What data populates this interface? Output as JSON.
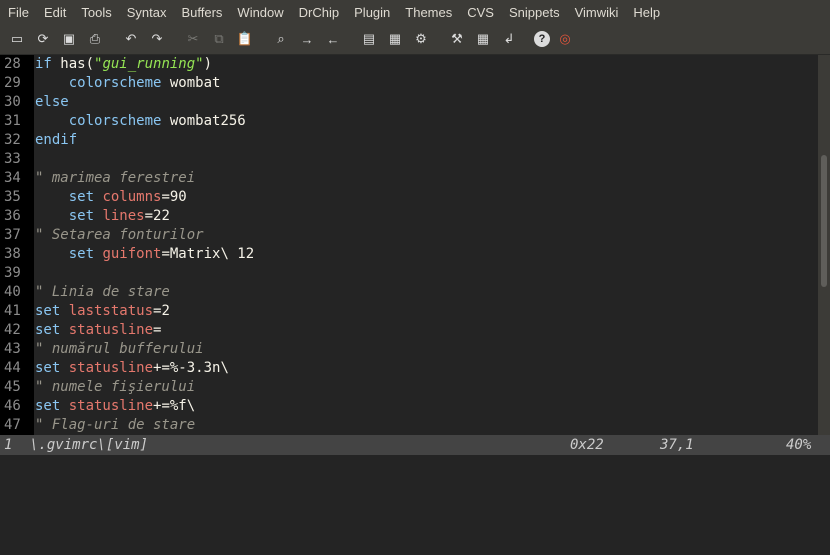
{
  "menu": [
    "File",
    "Edit",
    "Tools",
    "Syntax",
    "Buffers",
    "Window",
    "DrChip",
    "Plugin",
    "Themes",
    "CVS",
    "Snippets",
    "Vimwiki",
    "Help"
  ],
  "toolbar_icons": [
    "open-icon",
    "reload-icon",
    "save-icon",
    "print-icon",
    "undo-icon",
    "redo-icon",
    "cut-icon",
    "copy-icon",
    "paste-icon",
    "find-icon",
    "find-next-icon",
    "find-prev-icon",
    "load-session-icon",
    "save-session-icon",
    "run-script-icon",
    "make-icon",
    "tags-icon",
    "jump-icon",
    "help-icon",
    "lifebuoy-icon"
  ],
  "lines": [
    {
      "n": "28",
      "t": [
        [
          "kw",
          "if "
        ],
        [
          "",
          "has("
        ],
        [
          "str",
          "\"gui_running\""
        ],
        [
          "",
          ")"
        ]
      ]
    },
    {
      "n": "29",
      "t": [
        [
          "",
          "    "
        ],
        [
          "kw",
          "colorscheme"
        ],
        [
          "",
          " wombat"
        ]
      ]
    },
    {
      "n": "30",
      "t": [
        [
          "kw",
          "else"
        ]
      ]
    },
    {
      "n": "31",
      "t": [
        [
          "",
          "    "
        ],
        [
          "kw",
          "colorscheme"
        ],
        [
          "",
          " wombat256"
        ]
      ]
    },
    {
      "n": "32",
      "t": [
        [
          "kw",
          "endif"
        ]
      ]
    },
    {
      "n": "33",
      "t": []
    },
    {
      "n": "34",
      "t": [
        [
          "cmt",
          "\" marimea ferestrei"
        ]
      ]
    },
    {
      "n": "35",
      "t": [
        [
          "",
          "    "
        ],
        [
          "kw",
          "set "
        ],
        [
          "opt",
          "columns"
        ],
        [
          "",
          "=90"
        ]
      ]
    },
    {
      "n": "36",
      "t": [
        [
          "",
          "    "
        ],
        [
          "kw",
          "set "
        ],
        [
          "opt",
          "lines"
        ],
        [
          "",
          "=22"
        ]
      ]
    },
    {
      "n": "37",
      "t": [
        [
          "cmt",
          "\" Setarea fonturilor"
        ]
      ]
    },
    {
      "n": "38",
      "t": [
        [
          "",
          "    "
        ],
        [
          "kw",
          "set "
        ],
        [
          "opt",
          "guifont"
        ],
        [
          "",
          "=Matrix\\ 12"
        ]
      ]
    },
    {
      "n": "39",
      "t": []
    },
    {
      "n": "40",
      "t": [
        [
          "cmt",
          "\" Linia de stare"
        ]
      ]
    },
    {
      "n": "41",
      "t": [
        [
          "kw",
          "set "
        ],
        [
          "opt",
          "laststatus"
        ],
        [
          "",
          "=2"
        ]
      ]
    },
    {
      "n": "42",
      "t": [
        [
          "kw",
          "set "
        ],
        [
          "opt",
          "statusline"
        ],
        [
          "",
          "="
        ]
      ]
    },
    {
      "n": "43",
      "t": [
        [
          "cmt",
          "\" numărul bufferului"
        ]
      ]
    },
    {
      "n": "44",
      "t": [
        [
          "kw",
          "set "
        ],
        [
          "opt",
          "statusline"
        ],
        [
          "",
          "+=%-3.3n\\"
        ]
      ]
    },
    {
      "n": "45",
      "t": [
        [
          "cmt",
          "\" numele fişierului"
        ]
      ]
    },
    {
      "n": "46",
      "t": [
        [
          "kw",
          "set "
        ],
        [
          "opt",
          "statusline"
        ],
        [
          "",
          "+=%f\\"
        ]
      ]
    },
    {
      "n": "47",
      "t": [
        [
          "cmt",
          "\" Flag-uri de stare"
        ]
      ]
    }
  ],
  "status": {
    "bufnum": "1",
    "filename": "\\.gvimrc\\[vim]",
    "charcode": "0x22",
    "position": "37,1",
    "percent": "40%"
  }
}
